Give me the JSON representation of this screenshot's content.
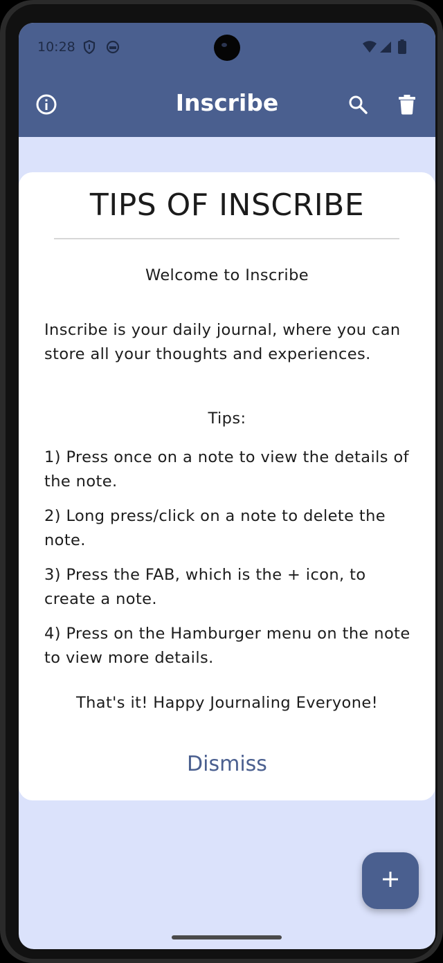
{
  "status_bar": {
    "time": "10:28"
  },
  "app_bar": {
    "title": "Inscribe",
    "color": "#4a5f8f"
  },
  "dialog": {
    "title": "TIPS OF INSCRIBE",
    "welcome": "Welcome to Inscribe",
    "intro": "Inscribe is your daily journal, where you can store all your thoughts and experiences.",
    "tips_heading": "Tips:",
    "tips": [
      "1) Press once on a note to view the details of the note.",
      "2) Long press/click on a note to delete the note.",
      "3) Press the FAB, which is the + icon, to create a note.",
      "4) Press on the Hamburger menu on the note to view more details."
    ],
    "closing": "That's it! Happy Journaling Everyone!",
    "dismiss_label": "Dismiss"
  },
  "icons": {
    "info": "info-icon",
    "search": "search-icon",
    "delete": "trash-icon",
    "add": "plus-icon"
  },
  "colors": {
    "background": "#dbe2fb",
    "accent": "#4a5f8f"
  }
}
